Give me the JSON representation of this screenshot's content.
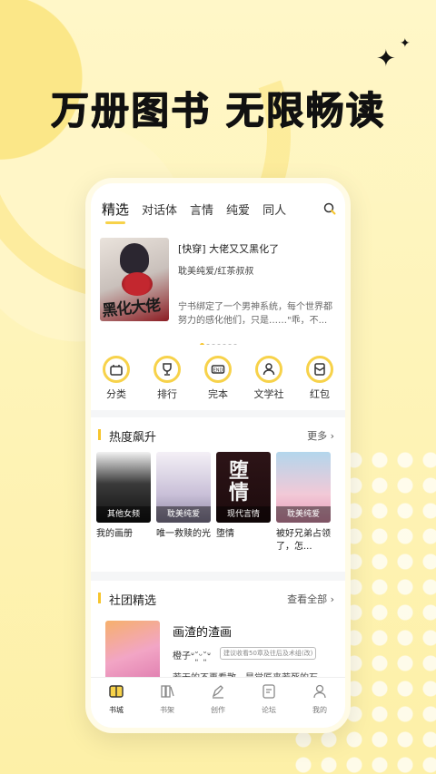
{
  "headline": "万册图书 无限畅读",
  "tabs": [
    {
      "label": "精选",
      "active": true
    },
    {
      "label": "对话体",
      "active": false
    },
    {
      "label": "言情",
      "active": false
    },
    {
      "label": "纯爱",
      "active": false
    },
    {
      "label": "同人",
      "active": false
    }
  ],
  "banner": {
    "title": "[快穿] 大佬又又黑化了",
    "tags": "耽美纯爱/红茶叔叔",
    "desc": "宁书绑定了一个男神系统，每个世界都努力的感化他们，只是……\"乖，不...",
    "cover_title": "黑化大佬"
  },
  "categories": [
    {
      "label": "分类",
      "icon": "category-icon"
    },
    {
      "label": "排行",
      "icon": "trophy-icon"
    },
    {
      "label": "完本",
      "icon": "end-icon"
    },
    {
      "label": "文学社",
      "icon": "community-icon"
    },
    {
      "label": "红包",
      "icon": "red-envelope-icon"
    }
  ],
  "hot": {
    "title": "热度飙升",
    "more": "更多",
    "books": [
      {
        "genre": "其他女频",
        "name": "我的画册"
      },
      {
        "genre": "耽美纯爱",
        "name": "唯一救赎的光"
      },
      {
        "genre": "现代言情",
        "name": "堕情"
      },
      {
        "genre": "耽美纯爱",
        "name": "被好兄弟占领了，怎..."
      }
    ],
    "cover3_text": "堕\n情"
  },
  "club": {
    "title": "社团精选",
    "more": "查看全部",
    "item_title": "画渣的渣画",
    "user": "橙子ᐡ˘͈ᵕ˘͈ᐡ",
    "tag": "建议收看50章及往后及术组(改)",
    "desc": "若无的不再看散，是觉匠来若死的石"
  },
  "bottom_nav": [
    {
      "label": "书城",
      "active": true
    },
    {
      "label": "书架",
      "active": false
    },
    {
      "label": "创作",
      "active": false
    },
    {
      "label": "论坛",
      "active": false
    },
    {
      "label": "我的",
      "active": false
    }
  ],
  "colors": {
    "accent": "#f7d24a",
    "background": "#fdf3b3"
  }
}
